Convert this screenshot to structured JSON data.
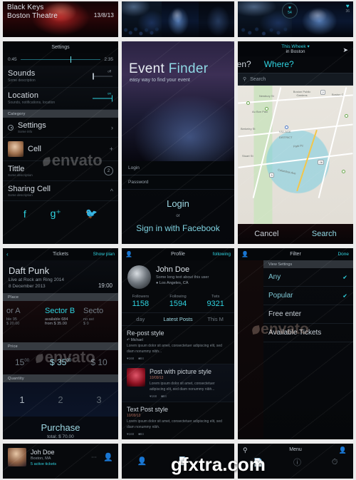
{
  "banners": {
    "left": {
      "artist": "Black Keys",
      "venue": "Boston Theatre",
      "date": "13/8/13"
    },
    "mid": {
      "likes": "54"
    },
    "right": {
      "likes": "36"
    }
  },
  "settings": {
    "nav_title": "Settings",
    "slider": {
      "current": "0:45",
      "total": "2:35"
    },
    "rows": [
      {
        "title": "Sounds",
        "subtitle": "Some description",
        "toggle": "off"
      },
      {
        "title": "Location",
        "subtitle": "Sounds, notifications, location",
        "toggle": "on"
      }
    ],
    "category_label": "Category",
    "cells": [
      {
        "title": "Settings",
        "subtitle": "Some info",
        "accessory": "chevron-right"
      },
      {
        "title": "Cell",
        "subtitle": "",
        "accessory": "plus"
      },
      {
        "title": "Tittle",
        "subtitle": "Some description",
        "accessory": "2"
      },
      {
        "title": "Sharing Cell",
        "subtitle": "Some description",
        "accessory": "chevron-up"
      }
    ],
    "social": [
      "facebook-icon",
      "google-plus-icon",
      "twitter-icon"
    ]
  },
  "finder": {
    "title_a": "Event",
    "title_b": "Finder",
    "subtitle": "easy way to find your event",
    "login_placeholder": "Login",
    "password_placeholder": "Password",
    "login_button": "Login",
    "or": "or",
    "facebook_button": "Sign in with Facebook"
  },
  "map": {
    "header_line1": "This Wheek",
    "header_line2": "in Boston",
    "when_label": "hen?",
    "where_label": "Where?",
    "search_placeholder": "Search",
    "labels": [
      "Newbury St",
      "Boston Public Gardens",
      "Au Bon Pain",
      "Park Pz",
      "Columbus Ave",
      "Boston C",
      "Stuart St",
      "VILLAGE",
      "DISTRICT",
      "Berkeley St"
    ],
    "shields": [
      "2",
      "28",
      "9"
    ],
    "cancel": "Cancel",
    "search": "Search"
  },
  "tickets": {
    "nav_title": "Tickets",
    "nav_right": "Show plan",
    "back_icon": "chevron-left-icon",
    "event_name": "Daft Punk",
    "event_sub": "Live at Rock am Ring 2014",
    "event_date": "8 December 2013",
    "event_time": "19:00",
    "place_label": "Place",
    "sectors": [
      {
        "name": "or A",
        "line1": "ble 95",
        "line2": "$ 20.00",
        "active": false
      },
      {
        "name": "Sector B",
        "line1": "available 684",
        "line2": "from $ 35.00",
        "active": true
      },
      {
        "name": "Secto",
        "line1": "no avi",
        "line2": "$ 0",
        "active": false
      }
    ],
    "price_label": "Price",
    "prices": [
      {
        "value": "15",
        "cents": "00",
        "active": false
      },
      {
        "value": "$ 35",
        "cents": "00",
        "active": true
      },
      {
        "value": "$ 10",
        "cents": "",
        "active": false
      }
    ],
    "quantity_label": "Quantity",
    "quantities": [
      {
        "n": "1",
        "active": true
      },
      {
        "n": "2",
        "active": false
      },
      {
        "n": "3",
        "active": false
      }
    ],
    "purchase_button": "Purchase",
    "purchase_total": "total: $ 70.00"
  },
  "profile": {
    "nav_title": "Profile",
    "nav_right": "following",
    "nav_icon": "person-add-icon",
    "name": "John Doe",
    "description": "Some long text about this user",
    "location": "Los Angeles, CA",
    "location_icon": "pin-icon",
    "stats": [
      {
        "key": "Followers",
        "value": "1158"
      },
      {
        "key": "Following",
        "value": "1594"
      },
      {
        "key": "Twts",
        "value": "9321"
      }
    ],
    "tabs": [
      {
        "label": "day",
        "active": false
      },
      {
        "label": "Latest Posts",
        "active": true
      },
      {
        "label": "This M",
        "active": false
      }
    ],
    "posts": [
      {
        "title": "Re-post style",
        "date": "",
        "by": "Michael",
        "by_icon": "repost-icon",
        "body": "Lorem ipsum dolor sit amet, consectetuer adipiscing elit, sed diam nonummy nibh...",
        "likes": "168",
        "comments": "84",
        "has_picture": false
      },
      {
        "title": "Post with picture style",
        "date": "10/09/13",
        "by": "",
        "body": "Lorem ipsum dolor sit amet, consectetuer adipiscing elit, sed diam nonummy nibh...",
        "likes": "168",
        "comments": "84",
        "has_picture": true
      },
      {
        "title": "Text Post style",
        "date": "10/09/13",
        "by": "",
        "body": "Lorem ipsum dolor sit amet, consectetuer adipiscing elit, sed diam nonummy nibh.",
        "likes": "168",
        "comments": "84",
        "has_picture": false
      }
    ]
  },
  "filter": {
    "nav_title": "Filter",
    "nav_right": "Done",
    "nav_icon": "person-add-icon",
    "section_label": "View Settings",
    "items": [
      {
        "label": "Any",
        "checked": true,
        "highlight": true
      },
      {
        "label": "Popular",
        "checked": true,
        "highlight": true
      },
      {
        "label": "Free enter",
        "checked": false,
        "highlight": false
      },
      {
        "label": "Available Tickets",
        "checked": false,
        "highlight": false
      }
    ]
  },
  "bottom": {
    "user_cell": {
      "name": "Joh Doe",
      "city": "Boston, MA",
      "tickets": "5 active tickets",
      "more_icon": "ellipsis-icon",
      "action_icon": "person-add-icon"
    },
    "tabbar": [
      {
        "icon": "person-add-icon",
        "active": true
      },
      {
        "icon": "document-icon",
        "active": false
      }
    ],
    "menu": {
      "title": "Menu",
      "search_icon": "search-icon",
      "person_icon": "person-add-icon",
      "tabs": [
        "document-icon",
        "info-icon",
        "clock-icon"
      ]
    }
  },
  "watermarks": {
    "envato": "envato",
    "gfxtra": "gfxtra.com"
  },
  "colors": {
    "accent": "#2fd3e0",
    "background": "#07090c",
    "sheet": "#ececec"
  }
}
